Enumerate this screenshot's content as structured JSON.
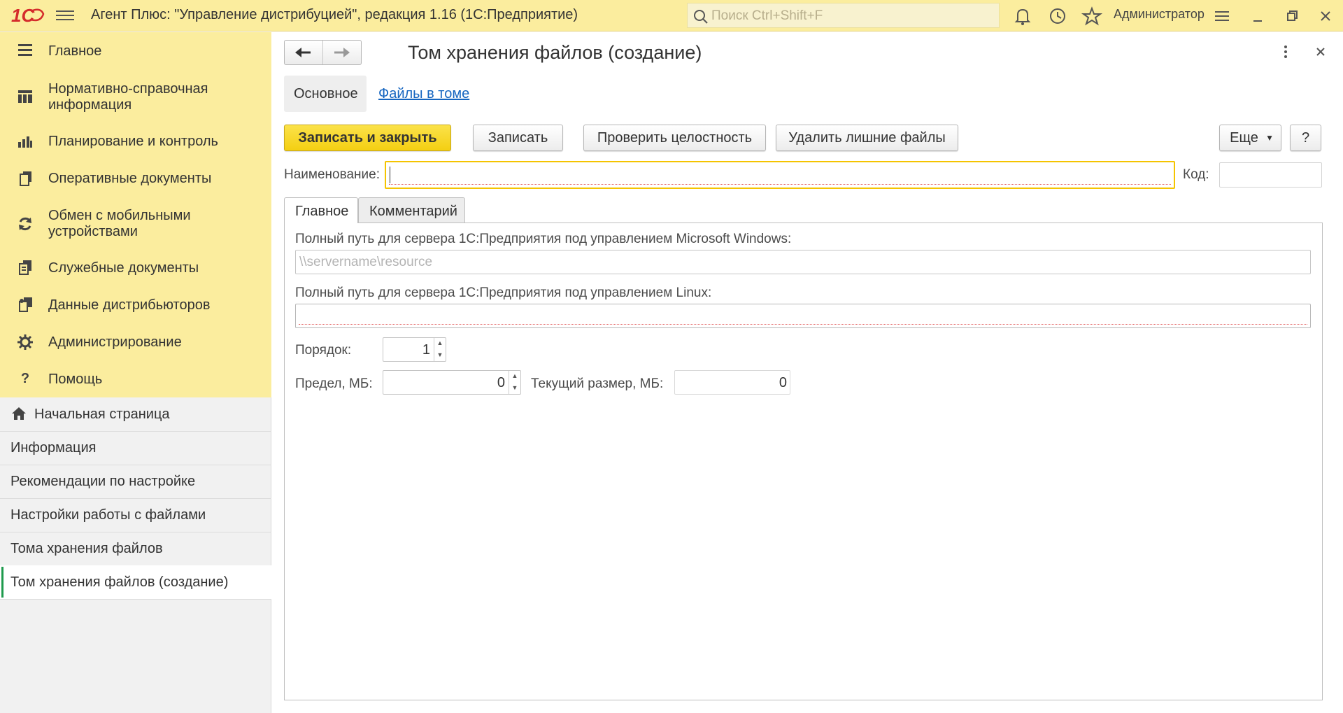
{
  "app": {
    "logo_text": "1С",
    "title": "Агент Плюс: \"Управление дистрибуцией\", редакция 1.16  (1С:Предприятие)",
    "search_placeholder": "Поиск Ctrl+Shift+F",
    "user": "Администратор"
  },
  "sidebar": {
    "menu": [
      {
        "label": "Главное",
        "icon": "list-icon"
      },
      {
        "label": "Нормативно-справочная информация",
        "icon": "catalog-icon"
      },
      {
        "label": "Планирование и контроль",
        "icon": "chart-icon"
      },
      {
        "label": "Оперативные документы",
        "icon": "documents-icon"
      },
      {
        "label": "Обмен с мобильными устройствами",
        "icon": "sync-icon"
      },
      {
        "label": "Служебные документы",
        "icon": "service-docs-icon"
      },
      {
        "label": "Данные дистрибьюторов",
        "icon": "distributors-icon"
      },
      {
        "label": "Администрирование",
        "icon": "gear-icon"
      },
      {
        "label": "Помощь",
        "icon": "help-icon"
      }
    ],
    "windows": [
      {
        "label": "Начальная страница",
        "icon": "home-icon"
      },
      {
        "label": "Информация"
      },
      {
        "label": "Рекомендации по настройке"
      },
      {
        "label": "Настройки работы с файлами"
      },
      {
        "label": "Тома хранения файлов"
      },
      {
        "label": "Том хранения файлов (создание)",
        "active": true
      }
    ]
  },
  "form": {
    "title": "Том хранения файлов (создание)",
    "nav_tabs": {
      "main": "Основное",
      "files": "Файлы в томе"
    },
    "buttons": {
      "save_close": "Записать и закрыть",
      "save": "Записать",
      "check": "Проверить целостность",
      "delete_extra": "Удалить лишние файлы",
      "more": "Еще",
      "help": "?"
    },
    "name_label": "Наименование:",
    "name_value": "",
    "code_label": "Код:",
    "code_value": "",
    "tabs": {
      "main": "Главное",
      "comment": "Комментарий"
    },
    "windows_path_label": "Полный путь для сервера 1С:Предприятия под управлением Microsoft Windows:",
    "windows_path_placeholder": "\\\\servername\\resource",
    "linux_path_label": "Полный путь для сервера 1С:Предприятия под управлением Linux:",
    "linux_path_value": "",
    "order_label": "Порядок:",
    "order_value": "1",
    "limit_label": "Предел, МБ:",
    "limit_value": "0",
    "current_size_label": "Текущий размер, МБ:",
    "current_size_value": "0"
  },
  "colors": {
    "accent_yellow": "#fbed9e",
    "primary_button": "#f4cf12",
    "active_marker": "#1e9a4d",
    "link": "#1565c0"
  }
}
